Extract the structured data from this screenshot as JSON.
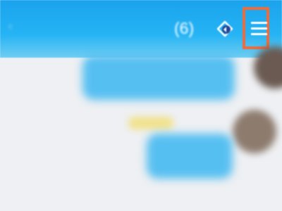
{
  "header": {
    "title": "",
    "member_count": "(6)",
    "menu_label": "",
    "members_icon": "members-icon",
    "menu_icon": "hamburger-menu-icon"
  },
  "colors": {
    "header_top": "#1ba3ee",
    "header_bottom": "#6fcdf3",
    "bubble": "#56bff1",
    "highlight": "#ef6b3b",
    "background": "#eef0f3"
  }
}
